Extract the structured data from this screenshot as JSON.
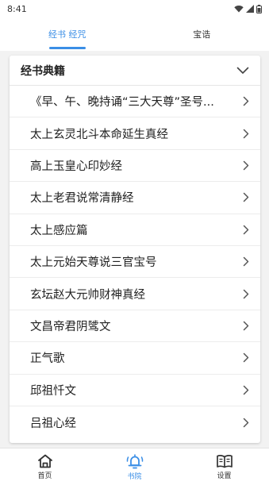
{
  "status_bar": {
    "time": "8:41"
  },
  "top_tabs": [
    {
      "label": "经书 经咒",
      "active": true
    },
    {
      "label": "宝诰",
      "active": false
    }
  ],
  "card": {
    "title": "经书典籍",
    "items": [
      {
        "label": "《早、午、晚持诵“三大天尊”圣号..."
      },
      {
        "label": "太上玄灵北斗本命延生真经"
      },
      {
        "label": "高上玉皇心印妙经"
      },
      {
        "label": "太上老君说常清静经"
      },
      {
        "label": "太上感应篇"
      },
      {
        "label": "太上元始天尊说三官宝号"
      },
      {
        "label": "玄坛赵大元帅财神真经"
      },
      {
        "label": "文昌帝君阴骘文"
      },
      {
        "label": "正气歌"
      },
      {
        "label": "邱祖忏文"
      },
      {
        "label": "吕祖心经"
      }
    ]
  },
  "bottom_nav": [
    {
      "label": "首页",
      "icon": "home-icon",
      "active": false
    },
    {
      "label": "书院",
      "icon": "bell-icon",
      "active": true
    },
    {
      "label": "设置",
      "icon": "book-icon",
      "active": false
    }
  ],
  "colors": {
    "accent": "#3a8ee6",
    "background": "#f2f2f2"
  }
}
